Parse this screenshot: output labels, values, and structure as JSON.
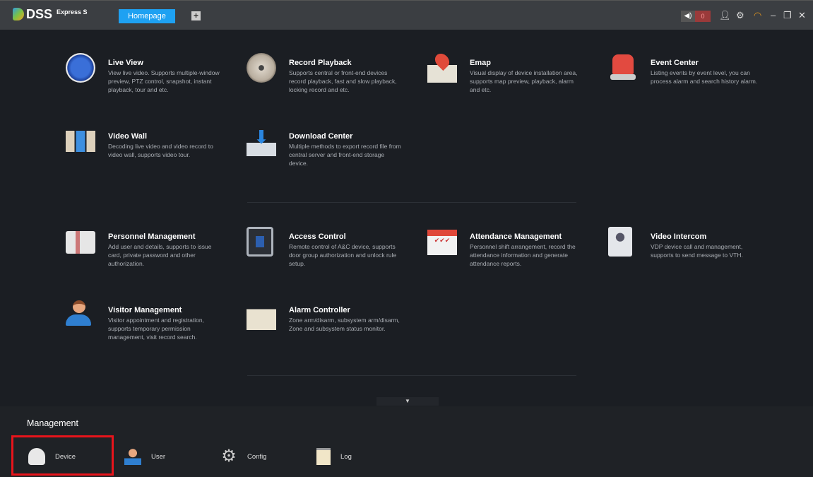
{
  "header": {
    "logo": "DSS",
    "logo_sub": "Express S",
    "tab": "Homepage",
    "add_tab": "+",
    "alarm_count": "0"
  },
  "modules": [
    {
      "title": "Live View",
      "desc": "View live video. Supports multiple-window preview, PTZ control, snapshot, instant playback, tour and etc."
    },
    {
      "title": "Record Playback",
      "desc": "Supports central or front-end devices record playback, fast and slow playback, locking record and etc."
    },
    {
      "title": "Emap",
      "desc": "Visual display of device installation area, supports map preview, playback, alarm and etc."
    },
    {
      "title": "Event Center",
      "desc": "Listing events by event level, you can process alarm and search history alarm."
    },
    {
      "title": "Video Wall",
      "desc": "Decoding live video and video record to video wall, supports video tour."
    },
    {
      "title": "Download Center",
      "desc": "Multiple methods to export record file from central server and front-end storage device."
    },
    {
      "title": "Personnel Management",
      "desc": "Add user and details, supports to issue card, private password and other authorization."
    },
    {
      "title": "Access Control",
      "desc": "Remote control of A&C device, supports door group authorization and unlock rule setup."
    },
    {
      "title": "Attendance Management",
      "desc": "Personnel shift arrangement, record the attendance information and generate attendance reports."
    },
    {
      "title": "Video Intercom",
      "desc": "VDP device call and management, supports to send message to VTH."
    },
    {
      "title": "Visitor Management",
      "desc": "Visitor appointment and registration, supports temporary permission management, visit record search."
    },
    {
      "title": "Alarm Controller",
      "desc": "Zone arm/disarm, subsystem arm/disarm, Zone and subsystem status monitor."
    }
  ],
  "management": {
    "title": "Management",
    "items": [
      {
        "label": "Device"
      },
      {
        "label": "User"
      },
      {
        "label": "Config"
      },
      {
        "label": "Log"
      }
    ]
  },
  "colors": {
    "accent": "#1ea1f2",
    "highlight": "#e8141b"
  }
}
